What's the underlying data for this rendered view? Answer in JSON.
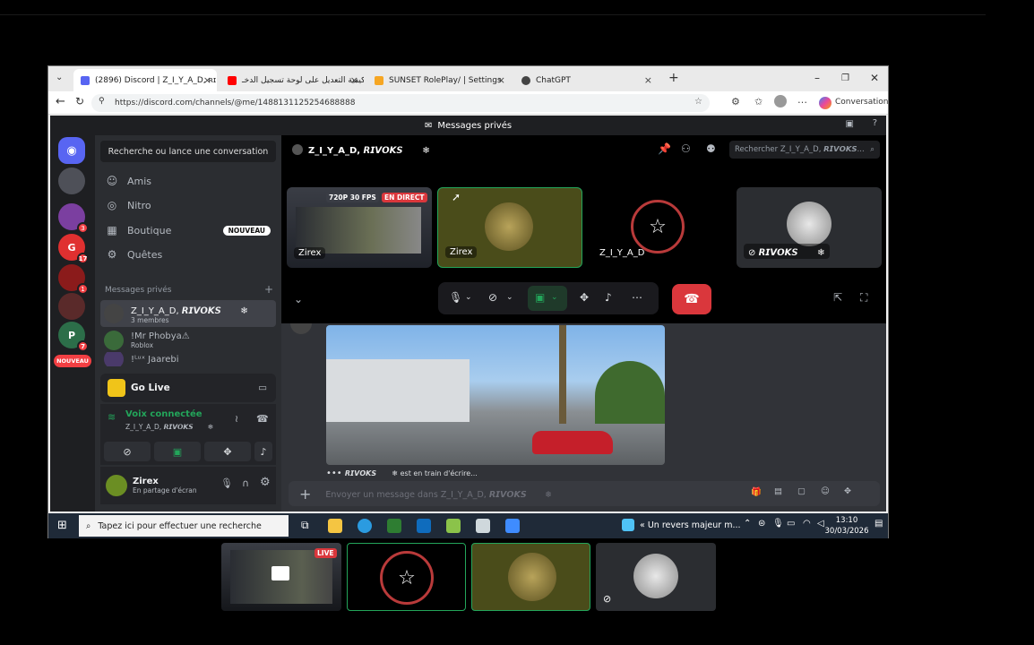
{
  "browser": {
    "tabs": [
      {
        "label": "(2896) Discord | Z_I_Y_A_D, ʀɪ",
        "color": "#5865f2"
      },
      {
        "label": "كيفية التعديل على لوحة تسجيل الدخـ",
        "color": "#ff0000"
      },
      {
        "label": "SUNSET RolePlay/ | Settings",
        "color": "#f6a623"
      },
      {
        "label": "ChatGPT",
        "color": "#444444"
      }
    ],
    "url": "https://discord.com/channels/@me/1488131125254688888",
    "conversation_label": "Conversation"
  },
  "discord": {
    "title": "Messages privés",
    "search_button": "Recherche ou lance une conversation",
    "nav": [
      {
        "label": "Amis",
        "icon": "friends-icon"
      },
      {
        "label": "Nitro",
        "icon": "nitro-icon"
      },
      {
        "label": "Boutique",
        "icon": "shop-icon",
        "badge": "NOUVEAU"
      },
      {
        "label": "Quêtes",
        "icon": "quests-icon"
      }
    ],
    "dm_header": "Messages privés",
    "dms": [
      {
        "name": "Z_I_Y_A_D, 𝙍𝙄𝙑𝙊𝙆𝙎 ㅤㅤ❄",
        "sub": "3 membres",
        "selected": true
      },
      {
        "name": "!Mr Phobya⚠",
        "sub": "Roblox",
        "selected": false
      },
      {
        "name": "!ᴸᵘˣ Jaarebi",
        "sub": "",
        "selected": false
      }
    ],
    "guild_badges": [
      "3",
      "17",
      "1",
      "7"
    ],
    "guild_new_badge": "NOUVEAU",
    "golive_label": "Go Live",
    "voice_status": "Voix connectée",
    "voice_channel": "Z_I_Y_A_D, 𝙍𝙄𝙑𝙊𝙆𝙎 ㅤㅤ❄",
    "user_name": "Zirex",
    "user_status": "En partage d'écran",
    "channel_header": "Z_I_Y_A_D, 𝙍𝙄𝙑𝙊𝙆𝙎 ㅤㅤ❄",
    "channel_search": "Rechercher Z_I_Y_A_D, 𝙍𝙄𝙑𝙊𝙆𝙎...",
    "stream_quality": "720P 30 FPS",
    "stream_live": "EN DIRECT",
    "tiles": [
      {
        "label": "Zirex",
        "kind": "stream"
      },
      {
        "label": "Zirex",
        "kind": "camera"
      },
      {
        "label": "Z_I_Y_A_D",
        "kind": "avatar"
      },
      {
        "label": "𝙍𝙄𝙑𝙊𝙆𝙎 ㅤㅤ❄",
        "kind": "avatar"
      }
    ],
    "typing": "𝙍𝙄𝙑𝙊𝙆𝙎 ㅤㅤ❄ est en train d'écrire...",
    "message_placeholder": "Envoyer un message dans Z_I_Y_A_D, 𝙍𝙄𝙑𝙊𝙆𝙎 ㅤㅤ❄"
  },
  "taskbar": {
    "search": "Tapez ici pour effectuer une recherche",
    "news": "« Un revers majeur m...",
    "time": "13:10",
    "date": "30/03/2026"
  },
  "strip": {
    "live": "LIVE"
  },
  "colors": {
    "discord_blurple": "#5865f2",
    "green": "#23a55a",
    "red": "#da373c"
  }
}
